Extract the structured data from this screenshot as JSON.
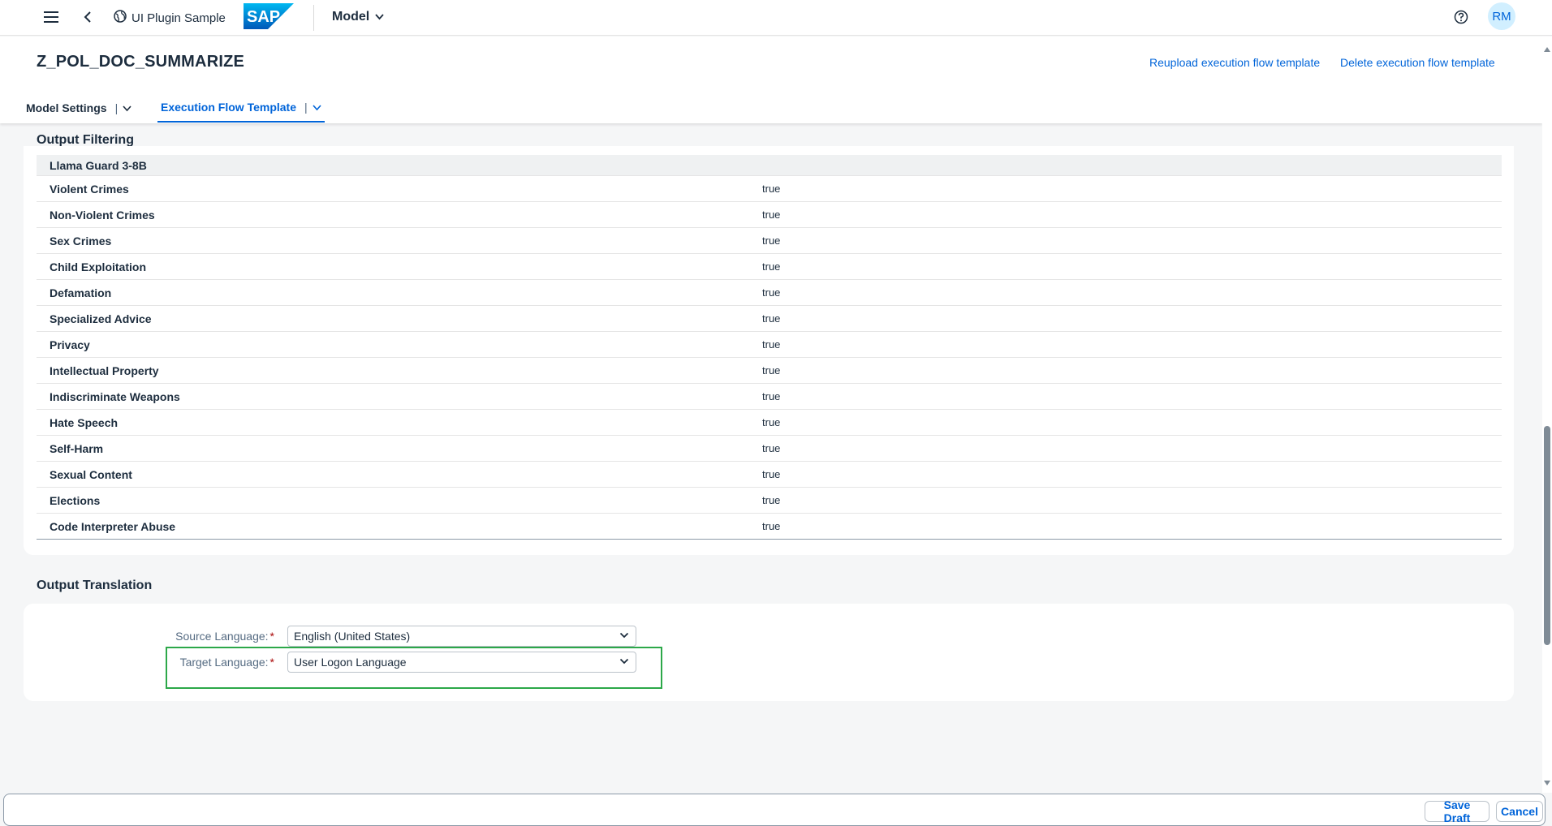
{
  "shell": {
    "app_title": "UI Plugin Sample",
    "logo_text": "SAP",
    "model_menu": "Model",
    "avatar_initials": "RM"
  },
  "header": {
    "title": "Z_POL_DOC_SUMMARIZE",
    "reupload_link": "Reupload execution flow template",
    "delete_link": "Delete execution flow template",
    "tabs": [
      {
        "label": "Model Settings",
        "active": false
      },
      {
        "label": "Execution Flow Template",
        "active": true
      }
    ]
  },
  "output_filtering": {
    "title": "Output Filtering",
    "group": "Llama Guard 3-8B",
    "rows": [
      {
        "name": "Violent Crimes",
        "value": "true"
      },
      {
        "name": "Non-Violent Crimes",
        "value": "true"
      },
      {
        "name": "Sex Crimes",
        "value": "true"
      },
      {
        "name": "Child Exploitation",
        "value": "true"
      },
      {
        "name": "Defamation",
        "value": "true"
      },
      {
        "name": "Specialized Advice",
        "value": "true"
      },
      {
        "name": "Privacy",
        "value": "true"
      },
      {
        "name": "Intellectual Property",
        "value": "true"
      },
      {
        "name": "Indiscriminate Weapons",
        "value": "true"
      },
      {
        "name": "Hate Speech",
        "value": "true"
      },
      {
        "name": "Self-Harm",
        "value": "true"
      },
      {
        "name": "Sexual Content",
        "value": "true"
      },
      {
        "name": "Elections",
        "value": "true"
      },
      {
        "name": "Code Interpreter Abuse",
        "value": "true"
      }
    ]
  },
  "output_translation": {
    "title": "Output Translation",
    "source_label": "Source Language:",
    "source_value": "English (United States)",
    "target_label": "Target Language:",
    "target_value": "User Logon Language",
    "required_mark": "*"
  },
  "footer": {
    "save_draft": "Save Draft",
    "cancel": "Cancel"
  },
  "colors": {
    "accent": "#0064d9",
    "highlight": "#2ca849",
    "required": "#aa0808"
  }
}
